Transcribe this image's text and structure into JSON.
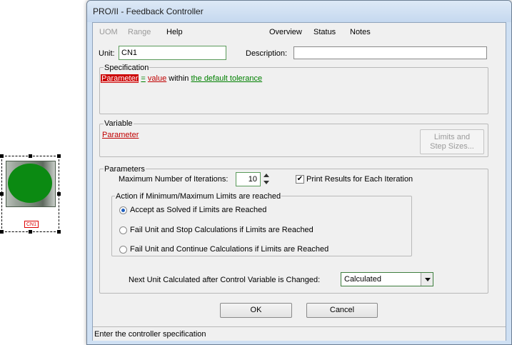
{
  "flowsheet_icon": {
    "label": "CN1"
  },
  "window": {
    "title": "PRO/II - Feedback Controller"
  },
  "menu": {
    "uom": "UOM",
    "range": "Range",
    "help": "Help",
    "overview": "Overview",
    "status": "Status",
    "notes": "Notes"
  },
  "unit": {
    "label": "Unit:",
    "value": "CN1",
    "description_label": "Description:",
    "description_value": ""
  },
  "specification": {
    "title": "Specification",
    "parameter": "Parameter",
    "operator": "=",
    "value": "value",
    "within": "within",
    "tolerance": "the default tolerance"
  },
  "variable": {
    "title": "Variable",
    "parameter": "Parameter",
    "limits_button_line1": "Limits and",
    "limits_button_line2": "Step Sizes..."
  },
  "parameters": {
    "title": "Parameters",
    "max_iterations_label": "Maximum Number of Iterations:",
    "max_iterations_value": "10",
    "print_results_label": "Print Results for Each Iteration",
    "print_results_checked": true,
    "limits_group_title": "Action if Minimum/Maximum Limits are reached",
    "options": [
      {
        "label": "Accept as Solved if Limits are Reached",
        "selected": true
      },
      {
        "label": "Fail Unit and Stop Calculations if Limits are Reached",
        "selected": false
      },
      {
        "label": "Fail Unit and Continue Calculations if Limits are Reached",
        "selected": false
      }
    ],
    "next_unit_label": "Next Unit Calculated after Control Variable is Changed:",
    "next_unit_value": "Calculated"
  },
  "buttons": {
    "ok": "OK",
    "cancel": "Cancel"
  },
  "status": {
    "text": "Enter the controller specification"
  },
  "colors": {
    "accent_red": "#c00000",
    "accent_green": "#008000",
    "unit_icon_green": "#0b8a12"
  }
}
